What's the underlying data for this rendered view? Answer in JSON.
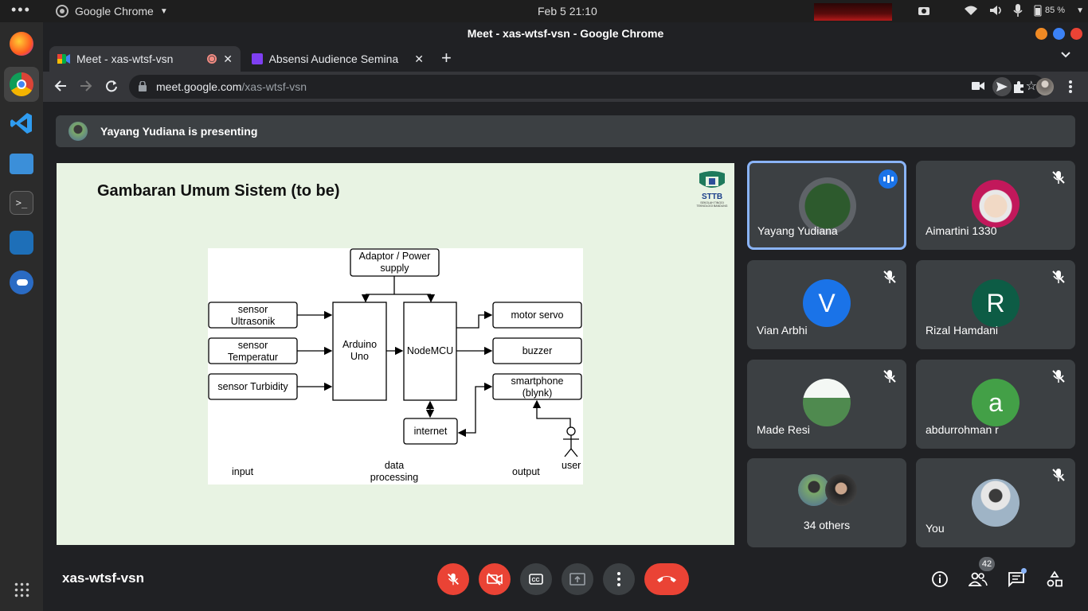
{
  "system": {
    "activities": "•••",
    "app_name": "Google Chrome",
    "clock": "Feb 5  21:10",
    "battery": "85 %"
  },
  "window": {
    "title": "Meet - xas-wtsf-vsn - Google Chrome"
  },
  "tabs": [
    {
      "label": "Meet - xas-wtsf-vsn",
      "icon": "meet-icon",
      "active": true
    },
    {
      "label": "Absensi Audience Semina",
      "icon": "forms-icon",
      "active": false
    }
  ],
  "address": {
    "host": "meet.google.com",
    "path": "/xas-wtsf-vsn"
  },
  "banner": {
    "text": "Yayang Yudiana is presenting"
  },
  "slide": {
    "title": "Gambaran Umum Sistem (to be)",
    "logo_text": "STTB",
    "logo_subtext": "SEKOLAH TINGGI TEKNOLOGI BANDUNG",
    "diagram": {
      "power": [
        "Adaptor / Power",
        "supply"
      ],
      "in1": [
        "sensor",
        "Ultrasonik"
      ],
      "in2": [
        "sensor",
        "Temperatur"
      ],
      "in3": "sensor Turbidity",
      "arduino": [
        "Arduino",
        "Uno"
      ],
      "nodemcu": "NodeMCU",
      "out1": "motor servo",
      "out2": "buzzer",
      "out3": [
        "smartphone",
        "(blynk)"
      ],
      "internet": "internet",
      "user": "user",
      "label_input": "input",
      "label_process": [
        "data",
        "processing"
      ],
      "label_output": "output"
    }
  },
  "participants": [
    {
      "name": "Yayang Yudiana",
      "speaking": true
    },
    {
      "name": "Aimartini 1330",
      "muted": true
    },
    {
      "name": "Vian Arbhi",
      "initial": "V",
      "color": "#1a73e8",
      "muted": true
    },
    {
      "name": "Rizal Hamdani",
      "initial": "R",
      "color": "#0d5c45",
      "muted": true
    },
    {
      "name": "Made Resi",
      "muted": true
    },
    {
      "name": "abdurrohman r",
      "initial": "a",
      "color": "#43a047",
      "muted": true
    },
    {
      "name": "34 others"
    },
    {
      "name": "You",
      "muted": true
    }
  ],
  "meeting": {
    "code": "xas-wtsf-vsn",
    "people_count": "42"
  },
  "colors": {
    "red": "#ea4335",
    "accent": "#8ab4f8",
    "tile": "#3c4043"
  }
}
